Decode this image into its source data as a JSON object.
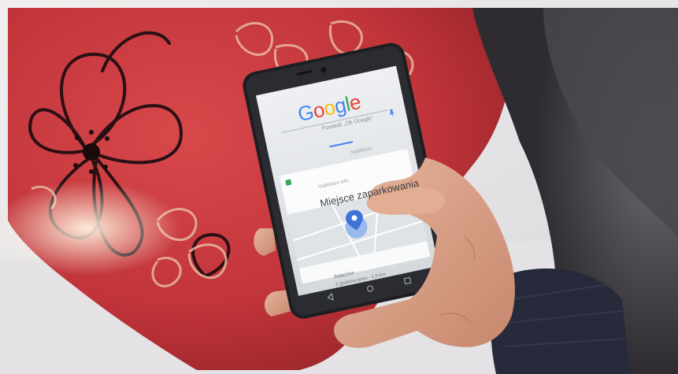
{
  "phone": {
    "logo_letters": [
      "G",
      "o",
      "o",
      "g",
      "l",
      "e"
    ],
    "logo_colors": [
      "#4285F4",
      "#EA4335",
      "#FBBC05",
      "#4285F4",
      "#34A853",
      "#EA4335"
    ],
    "search_hint": "Powiedz „Ok Google”",
    "tab_label": "Najbliższe",
    "card_header": "Najbliższe info",
    "card_title": "Miejsce zaparkowania",
    "footer_line1": "Bałąchów",
    "footer_line2": "1 godzina temu · 1,5 km",
    "pin_color": "#4285F4"
  },
  "scene_colors": {
    "fabric": "#c9383d",
    "pattern": "#2a1014",
    "background": "#e9e7e7",
    "skin": "#d9a48c",
    "sleeve": "#262a3a"
  }
}
